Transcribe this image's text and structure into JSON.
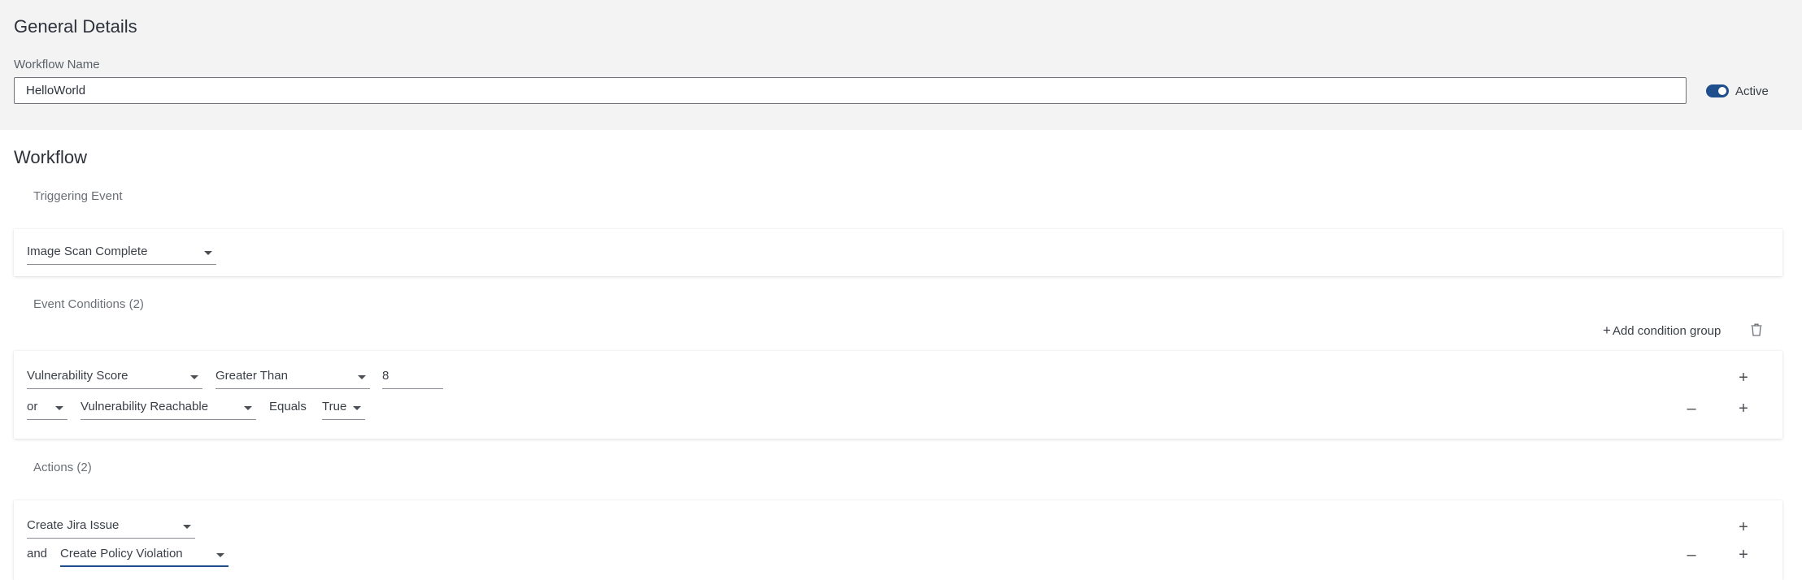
{
  "general": {
    "title": "General Details",
    "name_label": "Workflow Name",
    "name_value": "HelloWorld",
    "active_label": "Active",
    "active": true
  },
  "workflow": {
    "title": "Workflow",
    "triggering_label": "Triggering Event",
    "trigger_value": "Image Scan Complete",
    "conditions_label": "Event Conditions (2)",
    "add_condition_group": "Add condition group",
    "conditions": [
      {
        "field": "Vulnerability Score",
        "operator": "Greater Than",
        "value": "8"
      },
      {
        "connector": "or",
        "field": "Vulnerability Reachable",
        "operator": "Equals",
        "value": "True"
      }
    ],
    "actions_label": "Actions (2)",
    "actions": [
      {
        "action": "Create Jira Issue"
      },
      {
        "connector": "and",
        "action": "Create Policy Violation"
      }
    ]
  },
  "colors": {
    "accent": "#1f4e8c",
    "header_bg": "#f3f3f3"
  },
  "icons": [
    "chevron-down-icon",
    "plus-icon",
    "minus-icon",
    "trash-icon",
    "toggle-switch"
  ]
}
